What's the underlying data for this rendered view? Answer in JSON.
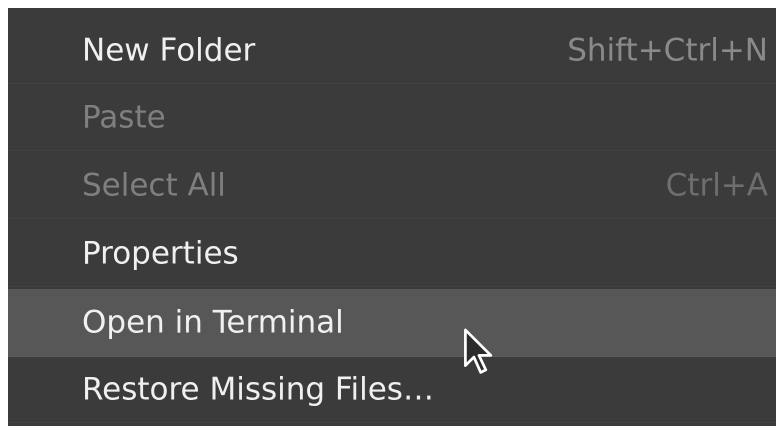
{
  "menu": {
    "items": [
      {
        "label": "New Folder",
        "accelerator": "Shift+Ctrl+N",
        "enabled": true
      },
      {
        "label": "Paste",
        "accelerator": "",
        "enabled": false
      },
      {
        "label": "Select All",
        "accelerator": "Ctrl+A",
        "enabled": false
      },
      {
        "label": "Properties",
        "accelerator": "",
        "enabled": true
      },
      {
        "label": "Open in Terminal",
        "accelerator": "",
        "enabled": true,
        "highlighted": true
      },
      {
        "label": "Restore Missing Files…",
        "accelerator": "",
        "enabled": true
      }
    ]
  },
  "cursor": {
    "icon": "arrow-pointer-icon"
  },
  "colors": {
    "menu_background": "#3b3b3b",
    "highlight_background": "#575757",
    "enabled_text": "#f0f0f0",
    "disabled_text": "#7f7f7f"
  }
}
